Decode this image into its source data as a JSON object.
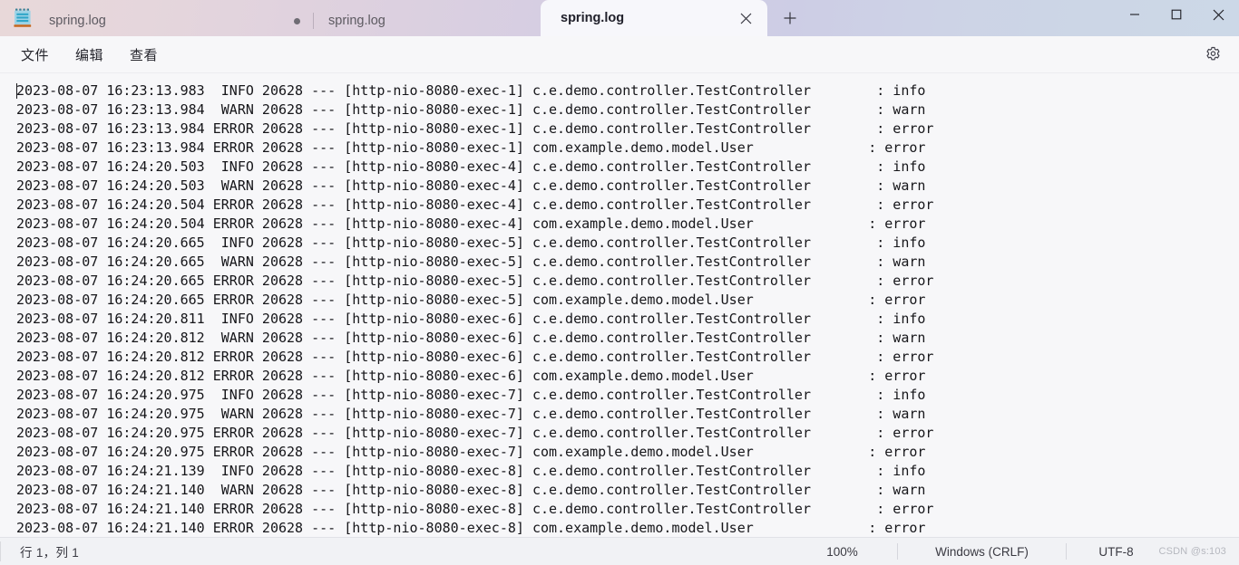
{
  "window": {
    "title": "spring.log",
    "controls": {
      "minimize": "─",
      "maximize": "□",
      "close": "✕"
    }
  },
  "tabs": {
    "items": [
      {
        "label": "spring.log",
        "active": false,
        "modified": false
      },
      {
        "label": "spring.log",
        "active": false,
        "modified": true
      },
      {
        "label": "spring.log",
        "active": true,
        "modified": false
      }
    ],
    "close_label": "✕",
    "new_tab_label": "＋",
    "app_icon": "notepad-icon"
  },
  "menubar": {
    "items": [
      {
        "label": "文件",
        "name": "menu-file"
      },
      {
        "label": "编辑",
        "name": "menu-edit"
      },
      {
        "label": "查看",
        "name": "menu-view"
      }
    ],
    "settings_icon": "gear-icon"
  },
  "editor": {
    "lines": [
      "2023-08-07 16:23:13.983  INFO 20628 --- [http-nio-8080-exec-1] c.e.demo.controller.TestController        : info",
      "2023-08-07 16:23:13.984  WARN 20628 --- [http-nio-8080-exec-1] c.e.demo.controller.TestController        : warn",
      "2023-08-07 16:23:13.984 ERROR 20628 --- [http-nio-8080-exec-1] c.e.demo.controller.TestController        : error",
      "2023-08-07 16:23:13.984 ERROR 20628 --- [http-nio-8080-exec-1] com.example.demo.model.User              : error",
      "2023-08-07 16:24:20.503  INFO 20628 --- [http-nio-8080-exec-4] c.e.demo.controller.TestController        : info",
      "2023-08-07 16:24:20.503  WARN 20628 --- [http-nio-8080-exec-4] c.e.demo.controller.TestController        : warn",
      "2023-08-07 16:24:20.504 ERROR 20628 --- [http-nio-8080-exec-4] c.e.demo.controller.TestController        : error",
      "2023-08-07 16:24:20.504 ERROR 20628 --- [http-nio-8080-exec-4] com.example.demo.model.User              : error",
      "2023-08-07 16:24:20.665  INFO 20628 --- [http-nio-8080-exec-5] c.e.demo.controller.TestController        : info",
      "2023-08-07 16:24:20.665  WARN 20628 --- [http-nio-8080-exec-5] c.e.demo.controller.TestController        : warn",
      "2023-08-07 16:24:20.665 ERROR 20628 --- [http-nio-8080-exec-5] c.e.demo.controller.TestController        : error",
      "2023-08-07 16:24:20.665 ERROR 20628 --- [http-nio-8080-exec-5] com.example.demo.model.User              : error",
      "2023-08-07 16:24:20.811  INFO 20628 --- [http-nio-8080-exec-6] c.e.demo.controller.TestController        : info",
      "2023-08-07 16:24:20.812  WARN 20628 --- [http-nio-8080-exec-6] c.e.demo.controller.TestController        : warn",
      "2023-08-07 16:24:20.812 ERROR 20628 --- [http-nio-8080-exec-6] c.e.demo.controller.TestController        : error",
      "2023-08-07 16:24:20.812 ERROR 20628 --- [http-nio-8080-exec-6] com.example.demo.model.User              : error",
      "2023-08-07 16:24:20.975  INFO 20628 --- [http-nio-8080-exec-7] c.e.demo.controller.TestController        : info",
      "2023-08-07 16:24:20.975  WARN 20628 --- [http-nio-8080-exec-7] c.e.demo.controller.TestController        : warn",
      "2023-08-07 16:24:20.975 ERROR 20628 --- [http-nio-8080-exec-7] c.e.demo.controller.TestController        : error",
      "2023-08-07 16:24:20.975 ERROR 20628 --- [http-nio-8080-exec-7] com.example.demo.model.User              : error",
      "2023-08-07 16:24:21.139  INFO 20628 --- [http-nio-8080-exec-8] c.e.demo.controller.TestController        : info",
      "2023-08-07 16:24:21.140  WARN 20628 --- [http-nio-8080-exec-8] c.e.demo.controller.TestController        : warn",
      "2023-08-07 16:24:21.140 ERROR 20628 --- [http-nio-8080-exec-8] c.e.demo.controller.TestController        : error",
      "2023-08-07 16:24:21.140 ERROR 20628 --- [http-nio-8080-exec-8] com.example.demo.model.User              : error"
    ]
  },
  "statusbar": {
    "position": "行 1，列 1",
    "zoom": "100%",
    "line_ending": "Windows (CRLF)",
    "encoding": "UTF-8",
    "watermark": "CSDN @s:103"
  },
  "colors": {
    "titlebar_start": "#e8d8d9",
    "titlebar_end": "#ccd8e7",
    "active_tab_bg": "#f7f7fb",
    "editor_bg": "#f7f7f9",
    "text": "#16161a",
    "statusbar_bg": "#f1f2f5"
  }
}
